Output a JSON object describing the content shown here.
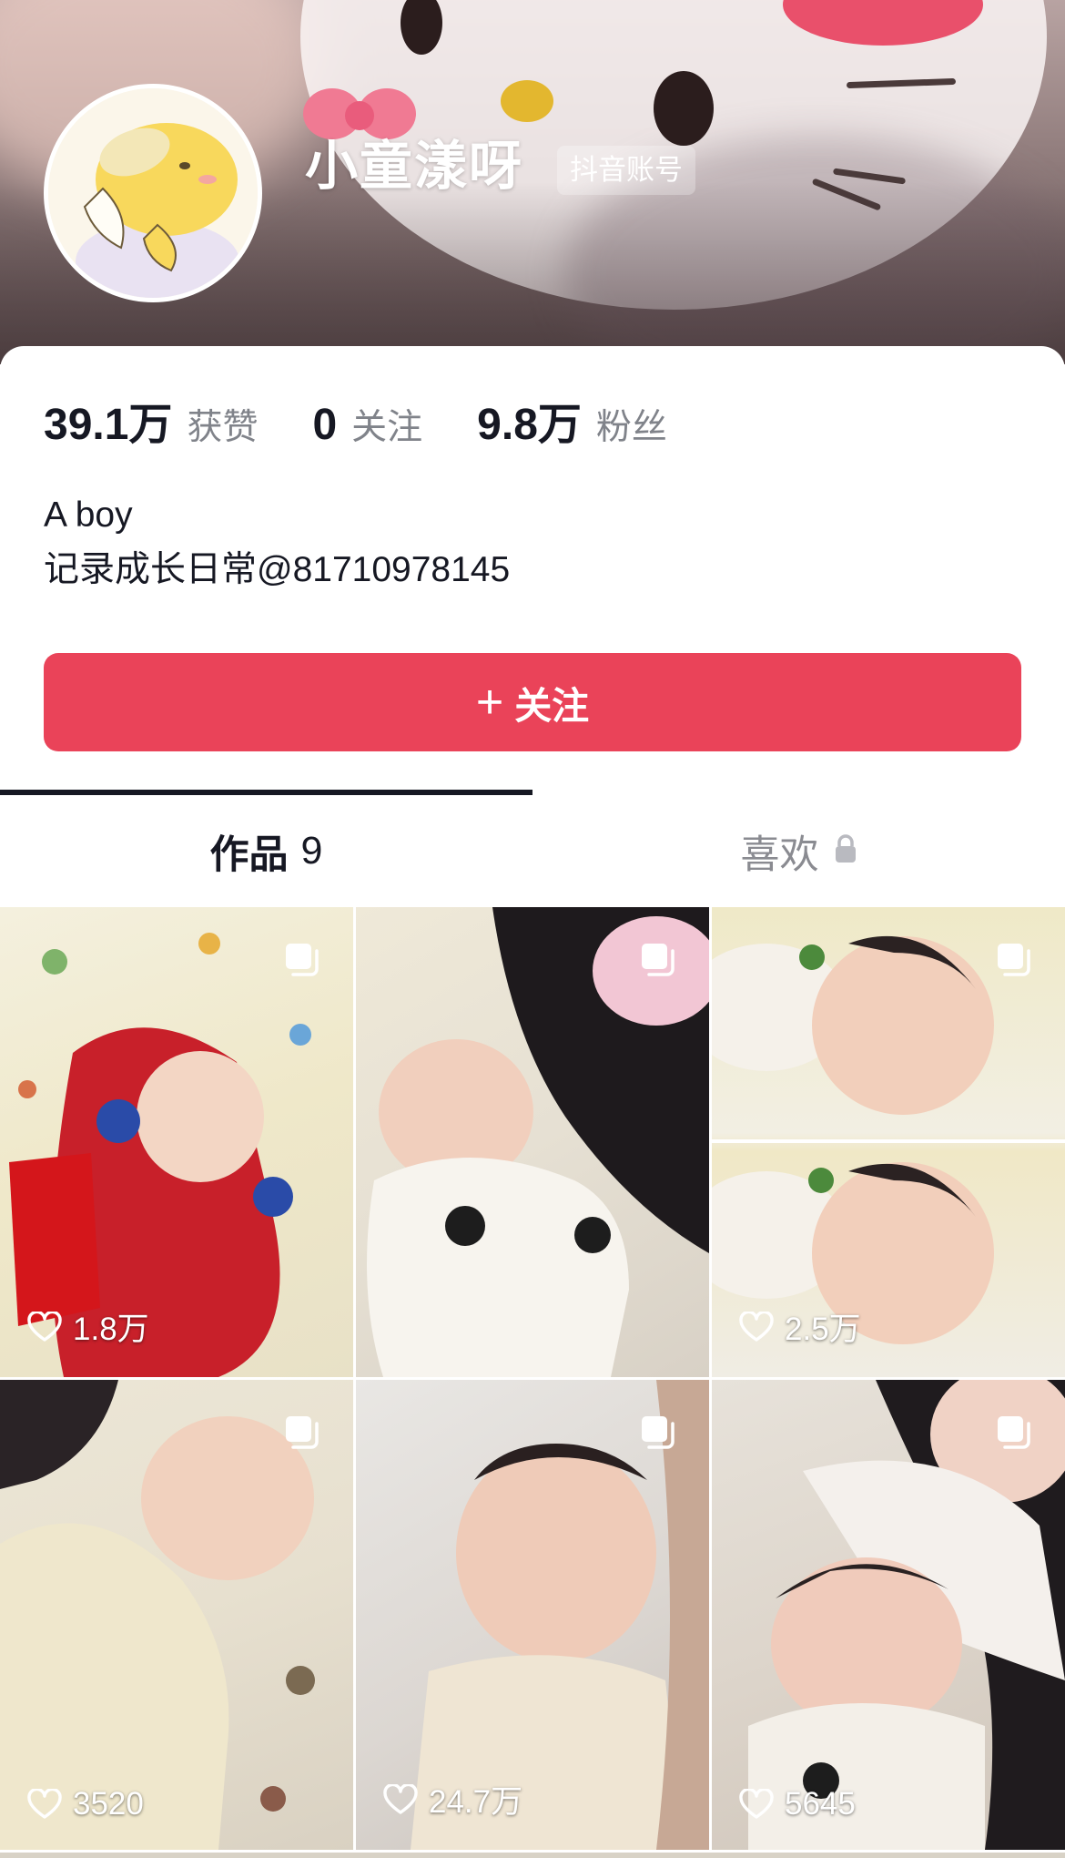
{
  "profile": {
    "username": "小童漾呀",
    "account_badge": "抖音账号"
  },
  "stats": [
    {
      "value": "39.1万",
      "label": "获赞"
    },
    {
      "value": "0",
      "label": "关注"
    },
    {
      "value": "9.8万",
      "label": "粉丝"
    }
  ],
  "bio": {
    "line1": "A boy",
    "line2": "记录成长日常@81710978145"
  },
  "follow_button": {
    "plus": "+",
    "label": "关注"
  },
  "tabs": {
    "works_label": "作品",
    "works_count": "9",
    "likes_label": "喜欢",
    "likes_icon": "lock-icon"
  },
  "colors": {
    "accent": "#ea4359",
    "text_primary": "#161823",
    "text_secondary": "#80838a"
  },
  "posts": [
    {
      "likes": "1.8万",
      "icon": "multi-image-icon"
    },
    {
      "likes": "",
      "icon": "multi-image-icon"
    },
    {
      "likes": "2.5万",
      "icon": "multi-image-icon"
    },
    {
      "likes": "3520",
      "icon": "multi-image-icon"
    },
    {
      "likes": "24.7万",
      "icon": "multi-image-icon"
    },
    {
      "likes": "5645",
      "icon": "multi-image-icon"
    }
  ]
}
